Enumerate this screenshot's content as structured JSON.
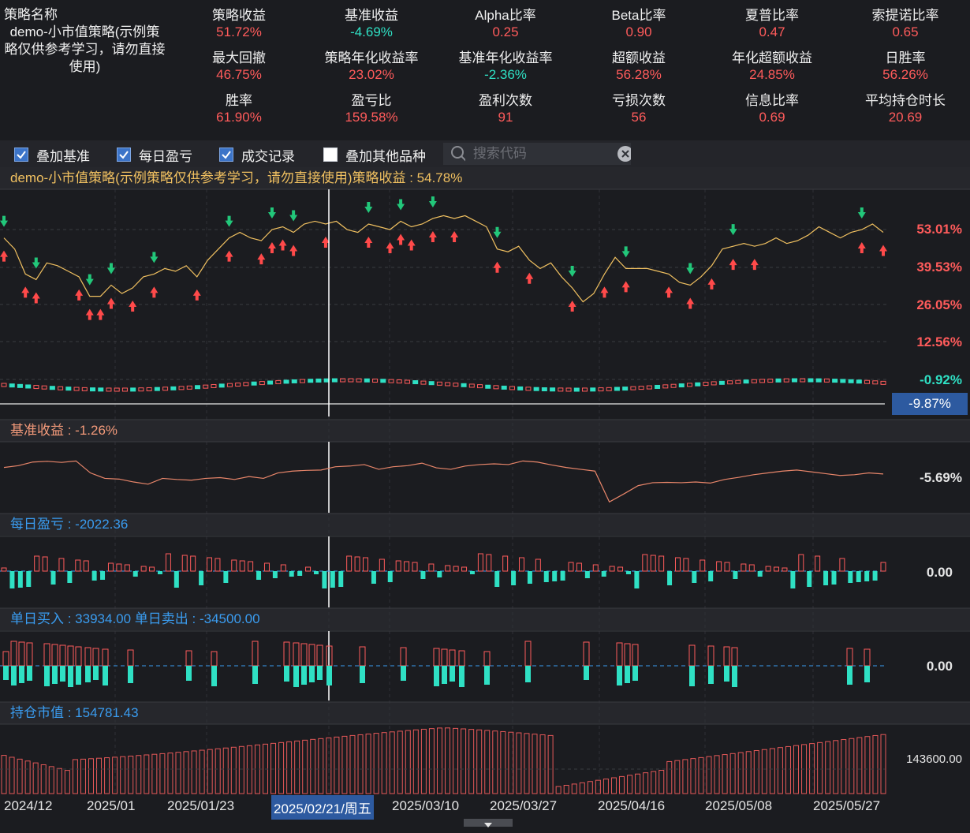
{
  "strategy_name": {
    "label": "策略名称",
    "value": "demo-小市值策略(示例策略仅供参考学习，请勿直接使用)"
  },
  "stats": [
    {
      "label": "策略收益",
      "value": "51.72%",
      "color": "#ff5b5b"
    },
    {
      "label": "基准收益",
      "value": "-4.69%",
      "color": "#2fe0c4"
    },
    {
      "label": "Alpha比率",
      "value": "0.25",
      "color": "#ff5b5b"
    },
    {
      "label": "Beta比率",
      "value": "0.90",
      "color": "#ff5b5b"
    },
    {
      "label": "夏普比率",
      "value": "0.47",
      "color": "#ff5b5b"
    },
    {
      "label": "索提诺比率",
      "value": "0.65",
      "color": "#ff5b5b"
    },
    {
      "label": "最大回撤",
      "value": "46.75%",
      "color": "#ff5b5b"
    },
    {
      "label": "策略年化收益率",
      "value": "23.02%",
      "color": "#ff5b5b"
    },
    {
      "label": "基准年化收益率",
      "value": "-2.36%",
      "color": "#2fe0c4"
    },
    {
      "label": "超额收益",
      "value": "56.28%",
      "color": "#ff5b5b"
    },
    {
      "label": "年化超额收益",
      "value": "24.85%",
      "color": "#ff5b5b"
    },
    {
      "label": "日胜率",
      "value": "56.26%",
      "color": "#ff5b5b"
    },
    {
      "label": "胜率",
      "value": "61.90%",
      "color": "#ff5b5b"
    },
    {
      "label": "盈亏比",
      "value": "159.58%",
      "color": "#ff5b5b"
    },
    {
      "label": "盈利次数",
      "value": "91",
      "color": "#ff5b5b"
    },
    {
      "label": "亏损次数",
      "value": "56",
      "color": "#ff5b5b"
    },
    {
      "label": "信息比率",
      "value": "0.69",
      "color": "#ff5b5b"
    },
    {
      "label": "平均持仓时长",
      "value": "20.69",
      "color": "#ff5b5b"
    }
  ],
  "toolbar": {
    "overlay_benchmark": {
      "label": "叠加基准",
      "checked": true
    },
    "daily_pnl": {
      "label": "每日盈亏",
      "checked": true
    },
    "trade_records": {
      "label": "成交记录",
      "checked": true
    },
    "overlay_other": {
      "label": "叠加其他品种",
      "checked": false
    },
    "search_placeholder": "搜索代码"
  },
  "panels": {
    "main_title": "demo-小市值策略(示例策略仅供参考学习，请勿直接使用)策略收益 : 54.78%",
    "main_axis": [
      "53.01%",
      "39.53%",
      "26.05%",
      "12.56%",
      "-0.92%"
    ],
    "cursor_value": "-9.87%",
    "benchmark_title": "基准收益 : -1.26%",
    "benchmark_axis": "-5.69%",
    "daily_title": "每日盈亏 : -2022.36",
    "daily_axis": "0.00",
    "trade_title": "单日买入 : 33934.00  单日卖出 : -34500.00",
    "trade_axis": "0.00",
    "position_title": "持仓市值 : 154781.43",
    "position_axis": "143600.00"
  },
  "x_axis": {
    "labels": [
      "2024/12",
      "2025/01",
      "2025/01/23",
      "2025/02/21/周五",
      "2025/03/10",
      "2025/03/27",
      "2025/04/16",
      "2025/05/08",
      "2025/05/27"
    ],
    "selected": "2025/02/21/周五"
  },
  "chart_data": {
    "type": "line",
    "strategy_return_pct": [
      50,
      46,
      37,
      35,
      41,
      40,
      38,
      36,
      29,
      29,
      33,
      30,
      32,
      36,
      37,
      39,
      38,
      40,
      36,
      42,
      46,
      50,
      52,
      50,
      49,
      53,
      54,
      52,
      55,
      56,
      55,
      56,
      53,
      52,
      55,
      54,
      53,
      56,
      54,
      55,
      57,
      58,
      57,
      58,
      56,
      54,
      46,
      45,
      47,
      42,
      39,
      41,
      36,
      32,
      27,
      30,
      37,
      43,
      39,
      39,
      39,
      38,
      37,
      34,
      33,
      36,
      40,
      46,
      47,
      48,
      47,
      48,
      50,
      48,
      49,
      51,
      54,
      52,
      50,
      52,
      53,
      55,
      52
    ],
    "benchmark_return_pct": [
      -3,
      -2.5,
      -1.5,
      -1.3,
      -1.6,
      -1.2,
      -4.5,
      -6,
      -6.2,
      -7,
      -7.6,
      -6,
      -6.3,
      -6.5,
      -6,
      -5.8,
      -6.3,
      -5.5,
      -6,
      -4.5,
      -4,
      -3.8,
      -3.7,
      -2.8,
      -2.6,
      -2.2,
      -3.5,
      -2.8,
      -2.5,
      -1.8,
      -3.1,
      -3.5,
      -2.6,
      -2.2,
      -2.0,
      -2.2,
      -1.2,
      -1.5,
      -2.3,
      -3.0,
      -3.5,
      -4,
      -12.5,
      -10.3,
      -8,
      -7.2,
      -7.1,
      -7.2,
      -7.0,
      -7.3,
      -6.3,
      -5.7,
      -5.0,
      -4.5,
      -4.0,
      -3.7,
      -4.2,
      -4.7,
      -5.2,
      -5.0,
      -4.5,
      -4.8
    ],
    "daily_pnl_sign": [
      1,
      -1,
      -1,
      -1,
      1,
      1,
      -1,
      1,
      -1,
      1,
      1,
      -1,
      -1,
      1,
      1,
      1,
      -1,
      1,
      1,
      -1,
      1,
      -1,
      1,
      1,
      -1,
      1,
      1,
      -1,
      1,
      1,
      1,
      -1,
      1,
      -1,
      1,
      -1,
      -1,
      1,
      -1,
      -1,
      -1,
      -1,
      1,
      1,
      1,
      -1,
      1,
      -1,
      1,
      1,
      1,
      -1,
      1,
      -1,
      1,
      1,
      1,
      -1,
      1,
      1,
      -1,
      1,
      -1,
      1,
      -1
    ],
    "position_value_trend": "rising to peak near 2025/03/27 then falling, low near 2025/04/16, recovering by 2025/05"
  }
}
